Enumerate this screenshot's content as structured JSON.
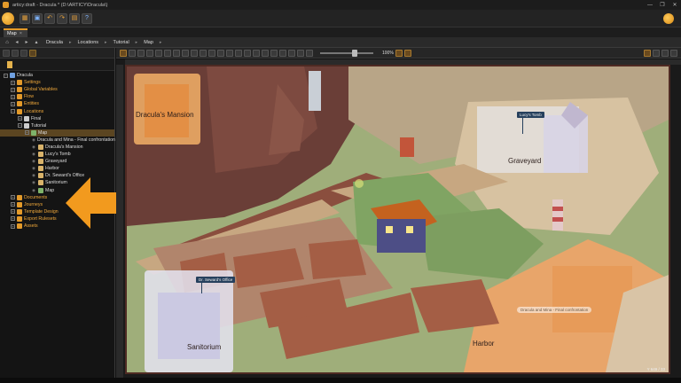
{
  "window": {
    "title": "articy:draft - Dracula * (D:\\ARTICY\\Dracula\\)",
    "controls": [
      "—",
      "❐",
      "✕"
    ]
  },
  "toolbar": {
    "buttons": [
      {
        "icon": "folder-icon",
        "glyph": "▦"
      },
      {
        "icon": "save-icon",
        "glyph": "▣"
      },
      {
        "icon": "undo-icon",
        "glyph": "↶"
      },
      {
        "icon": "redo-icon",
        "glyph": "↷"
      },
      {
        "icon": "book-icon",
        "glyph": "▤"
      },
      {
        "icon": "help-icon",
        "glyph": "?"
      }
    ]
  },
  "tabs": [
    {
      "label": "Map",
      "close": "×"
    }
  ],
  "breadcrumb": [
    "Dracula",
    "Locations",
    "Tutorial",
    "Map"
  ],
  "tree": [
    {
      "label": "Dracula",
      "level": 0,
      "icon": "blue",
      "exp": "−",
      "style": ""
    },
    {
      "label": "Settings",
      "level": 1,
      "icon": "fold",
      "exp": "+",
      "style": "or"
    },
    {
      "label": "Global Variables",
      "level": 1,
      "icon": "fold",
      "exp": "+",
      "style": "or"
    },
    {
      "label": "Flow",
      "level": 1,
      "icon": "fold",
      "exp": "+",
      "style": "or"
    },
    {
      "label": "Entities",
      "level": 1,
      "icon": "fold",
      "exp": "+",
      "style": "or"
    },
    {
      "label": "Locations",
      "level": 1,
      "icon": "fold",
      "exp": "−",
      "style": "or"
    },
    {
      "label": "Final",
      "level": 2,
      "icon": "doc",
      "exp": "+",
      "style": ""
    },
    {
      "label": "Tutorial",
      "level": 2,
      "icon": "doc",
      "exp": "−",
      "style": ""
    },
    {
      "label": "Map",
      "level": 3,
      "icon": "map",
      "exp": "−",
      "style": "",
      "selected": true
    },
    {
      "label": "Dracula and Mina - Final confrontation",
      "level": 4,
      "icon": "ent",
      "exp": "",
      "style": "",
      "eye": true
    },
    {
      "label": "Dracula's Mansion",
      "level": 4,
      "icon": "ent",
      "exp": "",
      "style": "",
      "eye": true
    },
    {
      "label": "Lucy's Tomb",
      "level": 4,
      "icon": "ent",
      "exp": "",
      "style": "",
      "eye": true
    },
    {
      "label": "Graveyard",
      "level": 4,
      "icon": "ent",
      "exp": "",
      "style": "",
      "eye": true
    },
    {
      "label": "Harbor",
      "level": 4,
      "icon": "ent",
      "exp": "",
      "style": "",
      "eye": true
    },
    {
      "label": "Dr. Seward's Office",
      "level": 4,
      "icon": "ent",
      "exp": "",
      "style": "",
      "eye": true
    },
    {
      "label": "Sanitorium",
      "level": 4,
      "icon": "ent",
      "exp": "",
      "style": "",
      "eye": true
    },
    {
      "label": "Map",
      "level": 4,
      "icon": "map",
      "exp": "",
      "style": "",
      "eye": true
    },
    {
      "label": "Documents",
      "level": 1,
      "icon": "fold",
      "exp": "+",
      "style": "or"
    },
    {
      "label": "Journeys",
      "level": 1,
      "icon": "fold",
      "exp": "+",
      "style": "or"
    },
    {
      "label": "Template Design",
      "level": 1,
      "icon": "fold",
      "exp": "+",
      "style": "or"
    },
    {
      "label": "Export Rulesets",
      "level": 1,
      "icon": "fold",
      "exp": "+",
      "style": "or"
    },
    {
      "label": "Assets",
      "level": 1,
      "icon": "fold",
      "exp": "+",
      "style": "or"
    }
  ],
  "maptoolbar": {
    "zoom": "100%"
  },
  "map": {
    "labels": {
      "mansion": "Dracula's Mansion",
      "graveyard": "Graveyard",
      "sanitorium": "Sanitorium",
      "harbor": "Harbor"
    },
    "pins": {
      "tomb": "Lucy's Tomb",
      "office": "Dr. Seward's Office",
      "final": "Dracula and Mina - Final confrontation"
    },
    "coord": "Y 649 / 33"
  },
  "colors": {
    "accent": "#e39a2a",
    "selection": "#5b4521",
    "pin": "#26405d"
  }
}
